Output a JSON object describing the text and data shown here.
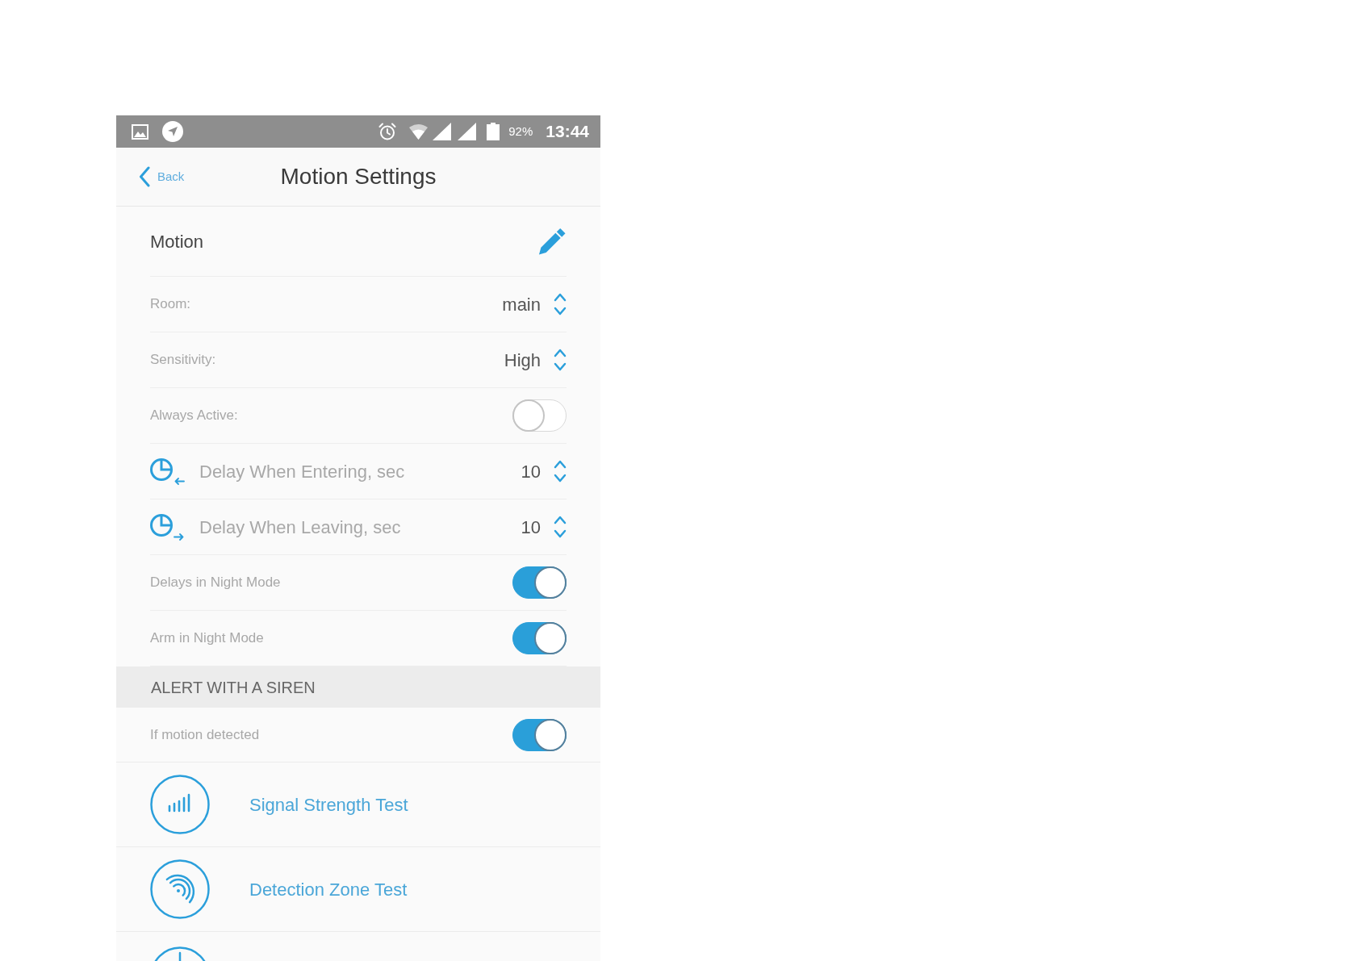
{
  "status_bar": {
    "battery": "92%",
    "time": "13:44"
  },
  "header": {
    "back": "Back",
    "title": "Motion Settings"
  },
  "device": {
    "name": "Motion"
  },
  "settings": [
    {
      "kind": "select",
      "label": "Room:",
      "value": "main"
    },
    {
      "kind": "select",
      "label": "Sensitivity:",
      "value": "High"
    },
    {
      "kind": "toggle",
      "label": "Always Active:",
      "on": false
    },
    {
      "kind": "delay_in",
      "label": "Delay When Entering, sec",
      "value": "10"
    },
    {
      "kind": "delay_out",
      "label": "Delay When Leaving, sec",
      "value": "10"
    },
    {
      "kind": "toggle",
      "label": "Delays in Night Mode",
      "on": true
    },
    {
      "kind": "toggle",
      "label": "Arm in Night Mode",
      "on": true
    }
  ],
  "siren": {
    "title": "ALERT WITH A SIREN",
    "rows": [
      {
        "label": "If motion detected",
        "on": true
      }
    ]
  },
  "tests": [
    {
      "kind": "signal",
      "label": "Signal Strength Test"
    },
    {
      "kind": "zone",
      "label": "Detection Zone Test"
    },
    {
      "kind": "partial"
    }
  ]
}
